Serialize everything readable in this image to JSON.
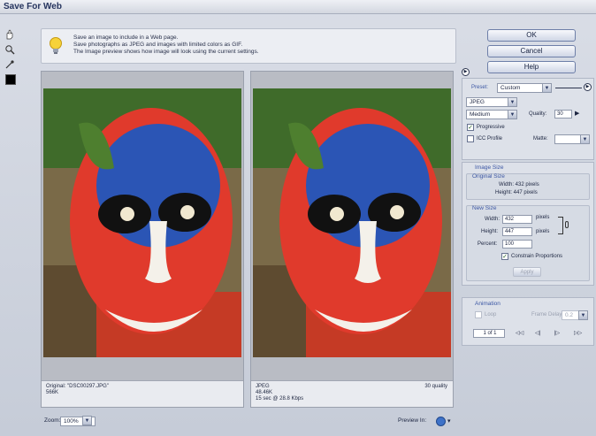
{
  "window": {
    "title": "Save For Web"
  },
  "hint": {
    "lines": [
      "Save an image to include in a Web page.",
      "Save photographs as JPEG and images with limited colors as GIF.",
      "The Image preview shows how image will look using the current settings."
    ]
  },
  "buttons": {
    "ok": "OK",
    "cancel": "Cancel",
    "help": "Help"
  },
  "preview": {
    "original": {
      "name": "Original: \"DSC00297.JPG\"",
      "size": "566K"
    },
    "optimized": {
      "format": "JPEG",
      "size": "48.46K",
      "time": "15 sec @ 28.8 Kbps",
      "quality": "30 quality"
    }
  },
  "bottom": {
    "zoom_label": "Zoom:",
    "zoom_value": "100%",
    "preview_label": "Preview In:"
  },
  "settings": {
    "preset_label": "Preset:",
    "preset_value": "Custom",
    "format": "JPEG",
    "compression": "Medium",
    "quality_label": "Quality:",
    "quality_value": "30",
    "progressive_label": "Progressive",
    "progressive_checked": true,
    "icc_label": "ICC Profile",
    "icc_checked": false,
    "matte_label": "Matte:"
  },
  "image_size": {
    "title": "Image Size",
    "original_title": "Original Size",
    "orig_width": "Width: 432 pixels",
    "orig_height": "Height: 447 pixels",
    "new_title": "New Size",
    "width_label": "Width:",
    "width_value": "432",
    "width_unit": "pixels",
    "height_label": "Height:",
    "height_value": "447",
    "height_unit": "pixels",
    "percent_label": "Percent:",
    "percent_value": "100",
    "constrain_label": "Constrain Proportions",
    "constrain_checked": true,
    "apply_label": "Apply"
  },
  "animation": {
    "title": "Animation",
    "loop_label": "Loop",
    "frame_delay_label": "Frame Delay:",
    "frame_delay_value": "0.2",
    "frame_counter": "1 of 1",
    "nav": [
      "◁◁",
      "◁|",
      "|▷",
      "▷▷"
    ]
  },
  "colors": {
    "accent": "#3c57a4",
    "window_bg": "#cdd2dd"
  }
}
